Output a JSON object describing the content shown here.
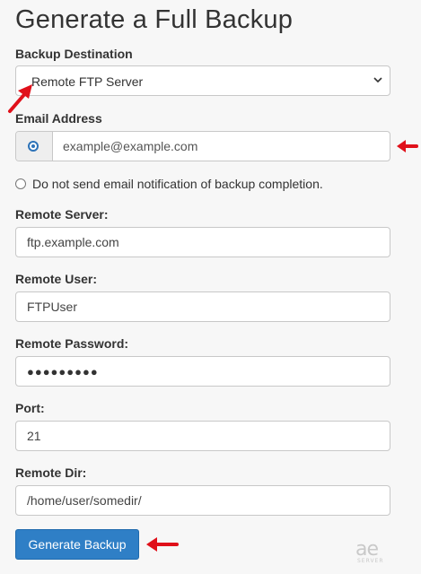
{
  "title": "Generate a Full Backup",
  "destination": {
    "label": "Backup Destination",
    "selected": "Remote FTP Server"
  },
  "email": {
    "label": "Email Address",
    "value": "example@example.com",
    "option_selected": true
  },
  "no_email": {
    "label": "Do not send email notification of backup completion.",
    "selected": false
  },
  "remote_server": {
    "label": "Remote Server:",
    "value": "ftp.example.com"
  },
  "remote_user": {
    "label": "Remote User:",
    "value": "FTPUser"
  },
  "remote_password": {
    "label": "Remote Password:",
    "masked": "●●●●●●●●●"
  },
  "port": {
    "label": "Port:",
    "value": "21"
  },
  "remote_dir": {
    "label": "Remote Dir:",
    "value": "/home/user/somedir/"
  },
  "submit_label": "Generate Backup",
  "watermark": {
    "logo": "ae",
    "sub": "SERVER"
  },
  "colors": {
    "primary_button": "#2f7fc6",
    "annotation_arrow": "#e0101a",
    "radio_checked": "#2d73b8"
  },
  "icons": [
    "chevron-down-icon",
    "radio-checked-icon",
    "radio-unchecked-icon",
    "red-arrow-annotation"
  ]
}
